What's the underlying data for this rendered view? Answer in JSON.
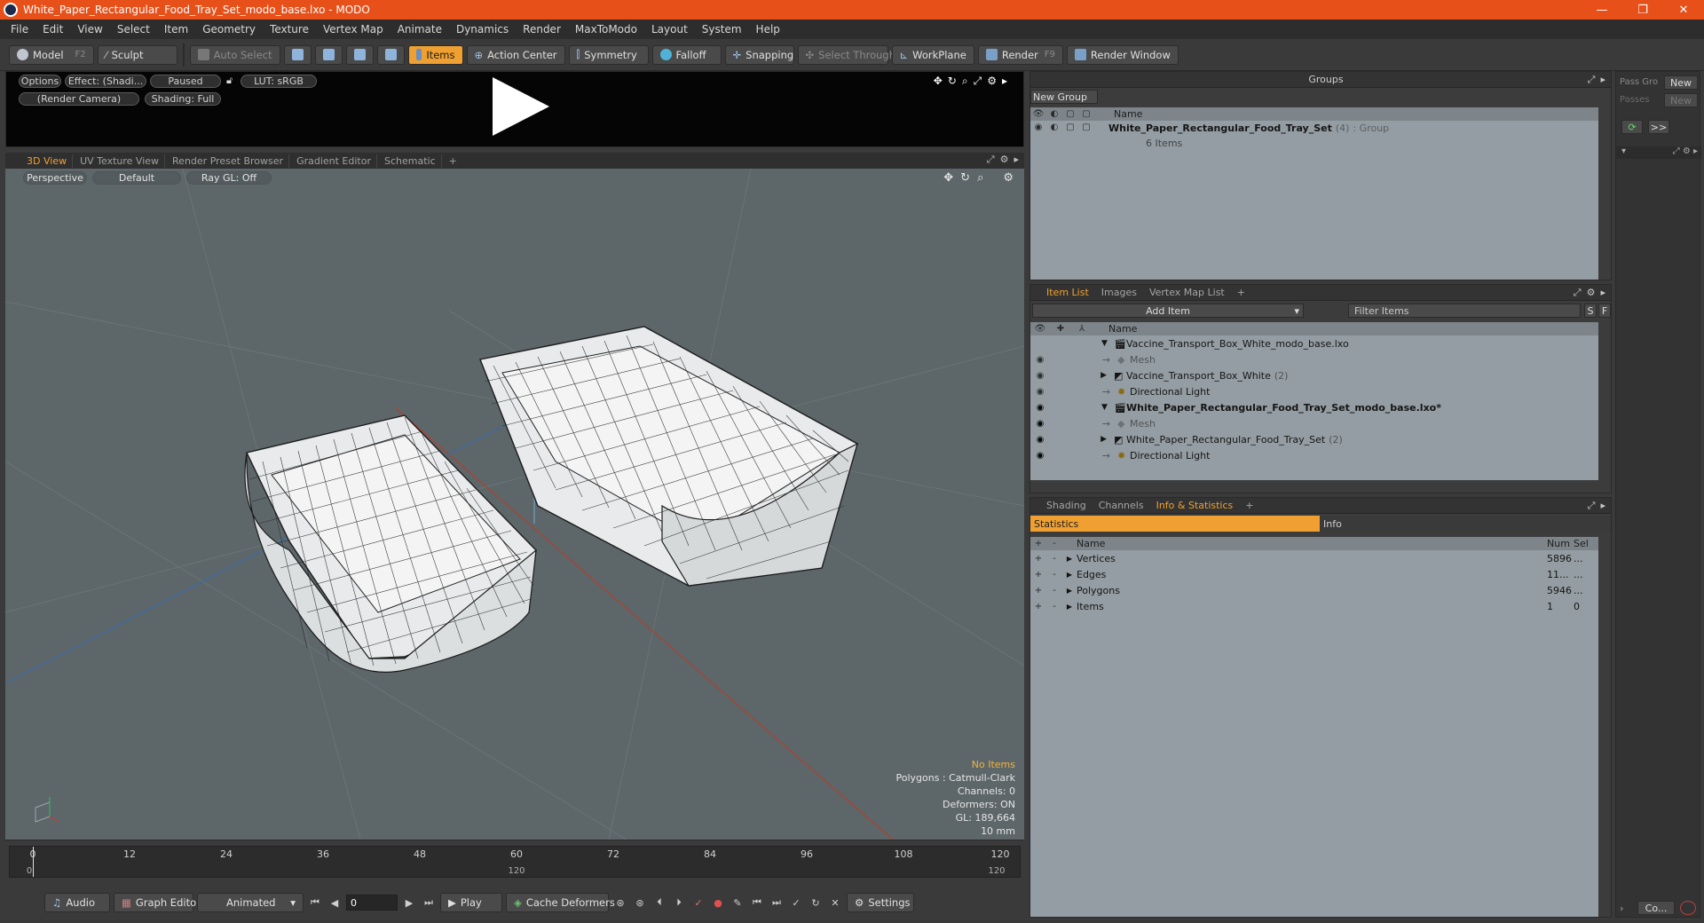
{
  "window": {
    "title": "White_Paper_Rectangular_Food_Tray_Set_modo_base.lxo - MODO",
    "min": "—",
    "max": "❐",
    "close": "✕"
  },
  "menu": [
    "File",
    "Edit",
    "View",
    "Select",
    "Item",
    "Geometry",
    "Texture",
    "Vertex Map",
    "Animate",
    "Dynamics",
    "Render",
    "MaxToModo",
    "Layout",
    "System",
    "Help"
  ],
  "toolbar": {
    "model": "Model",
    "model_key": "F2",
    "sculpt": "Sculpt",
    "auto_select": "Auto Select",
    "items": "Items",
    "action_center": "Action Center",
    "symmetry": "Symmetry",
    "falloff": "Falloff",
    "snapping": "Snapping",
    "select_through": "Select Through",
    "workplane": "WorkPlane",
    "render": "Render",
    "render_key": "F9",
    "render_window": "Render Window"
  },
  "preview": {
    "options": "Options",
    "effect": "Effect: (Shadi...",
    "paused": "Paused",
    "lut": "LUT: sRGB",
    "camera": "(Render Camera)",
    "shading": "Shading: Full"
  },
  "viewport_tabs": [
    "3D View",
    "UV Texture View",
    "Render Preset Browser",
    "Gradient Editor",
    "Schematic",
    "+"
  ],
  "viewport": {
    "perspective": "Perspective",
    "default": "Default",
    "raygl": "Ray GL: Off",
    "info": {
      "no_items": "No Items",
      "polygons": "Polygons : Catmull-Clark",
      "channels": "Channels: 0",
      "deformers": "Deformers: ON",
      "gl": "GL: 189,664",
      "scale": "10 mm"
    }
  },
  "timeline": {
    "ticks": [
      "0",
      "12",
      "24",
      "36",
      "48",
      "60",
      "72",
      "84",
      "96",
      "108",
      "120"
    ],
    "low": [
      "0",
      "120",
      "120"
    ]
  },
  "bottombar": {
    "audio": "Audio",
    "graph_editor": "Graph Editor",
    "animated": "Animated",
    "frame": "0",
    "play": "Play",
    "cache": "Cache Deformers",
    "settings": "Settings"
  },
  "groups": {
    "title": "Groups",
    "new_group": "New Group",
    "col_name": "Name",
    "item_name": "White_Paper_Rectangular_Food_Tray_Set",
    "item_count": "(4)",
    "item_type": ": Group",
    "item_sub": "6 Items"
  },
  "pass": {
    "pass_groups": "Pass Gro",
    "passes": "Passes",
    "new1": "New",
    "new2": "New",
    "more": ">>"
  },
  "itemlist": {
    "tabs": [
      "Item List",
      "Images",
      "Vertex Map List",
      "+"
    ],
    "add_item": "Add Item",
    "filter": "Filter Items",
    "s": "S",
    "f": "F",
    "col_name": "Name",
    "rows": [
      {
        "label": "Vaccine_Transport_Box_White_modo_base.lxo",
        "bold": false
      },
      {
        "label": "Mesh",
        "dim": true
      },
      {
        "label": "Vaccine_Transport_Box_White",
        "count": "(2)"
      },
      {
        "label": "Directional Light"
      },
      {
        "label": "White_Paper_Rectangular_Food_Tray_Set_modo_base.lxo*",
        "bold": true
      },
      {
        "label": "Mesh",
        "dim": true
      },
      {
        "label": "White_Paper_Rectangular_Food_Tray_Set",
        "count": "(2)"
      },
      {
        "label": "Directional Light"
      }
    ]
  },
  "stats": {
    "tabs": [
      "Shading",
      "Channels",
      "Info & Statistics",
      "+"
    ],
    "statistics": "Statistics",
    "info": "Info",
    "col_name": "Name",
    "col_num": "Num",
    "col_sel": "Sel",
    "rows": [
      {
        "name": "Vertices",
        "num": "5896",
        "sel": "..."
      },
      {
        "name": "Edges",
        "num": "11...",
        "sel": "..."
      },
      {
        "name": "Polygons",
        "num": "5946",
        "sel": "..."
      },
      {
        "name": "Items",
        "num": "1",
        "sel": "0"
      }
    ]
  },
  "side": {
    "co": "Co..."
  },
  "colors": {
    "accent": "#f0a030",
    "titlebar": "#e8501a",
    "viewport": "#5d6669"
  }
}
